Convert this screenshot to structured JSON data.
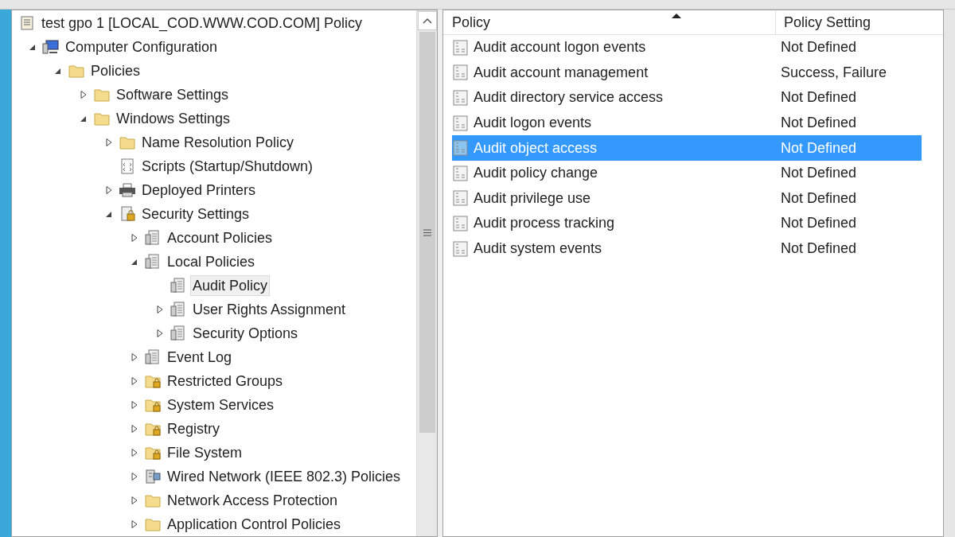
{
  "tree": {
    "label": "test gpo 1 [LOCAL_COD.WWW.COD.COM] Policy",
    "kind": "document",
    "selected": false,
    "children": [
      {
        "label": "Computer Configuration",
        "kind": "computer",
        "expanded": true,
        "selected": false,
        "children": [
          {
            "label": "Policies",
            "kind": "folder",
            "expanded": true,
            "selected": false,
            "children": [
              {
                "label": "Software Settings",
                "kind": "folder",
                "expanded": false,
                "selected": false
              },
              {
                "label": "Windows Settings",
                "kind": "folder",
                "expanded": true,
                "selected": false,
                "children": [
                  {
                    "label": "Name Resolution Policy",
                    "kind": "folder",
                    "expanded": false,
                    "selected": false
                  },
                  {
                    "label": "Scripts (Startup/Shutdown)",
                    "kind": "script",
                    "selected": false
                  },
                  {
                    "label": "Deployed Printers",
                    "kind": "printer",
                    "expanded": false,
                    "selected": false
                  },
                  {
                    "label": "Security Settings",
                    "kind": "security",
                    "expanded": true,
                    "selected": false,
                    "children": [
                      {
                        "label": "Account Policies",
                        "kind": "policy",
                        "expanded": false,
                        "selected": false
                      },
                      {
                        "label": "Local Policies",
                        "kind": "policy",
                        "expanded": true,
                        "selected": false,
                        "children": [
                          {
                            "label": "Audit Policy",
                            "kind": "policy",
                            "selected": true
                          },
                          {
                            "label": "User Rights Assignment",
                            "kind": "policy",
                            "expanded": false,
                            "selected": false
                          },
                          {
                            "label": "Security Options",
                            "kind": "policy",
                            "expanded": false,
                            "selected": false
                          }
                        ]
                      },
                      {
                        "label": "Event Log",
                        "kind": "policy",
                        "expanded": false,
                        "selected": false
                      },
                      {
                        "label": "Restricted Groups",
                        "kind": "locked-folder",
                        "expanded": false,
                        "selected": false
                      },
                      {
                        "label": "System Services",
                        "kind": "locked-folder",
                        "expanded": false,
                        "selected": false
                      },
                      {
                        "label": "Registry",
                        "kind": "locked-folder",
                        "expanded": false,
                        "selected": false
                      },
                      {
                        "label": "File System",
                        "kind": "locked-folder",
                        "expanded": false,
                        "selected": false
                      },
                      {
                        "label": "Wired Network (IEEE 802.3) Policies",
                        "kind": "network",
                        "expanded": false,
                        "selected": false
                      },
                      {
                        "label": "Network Access Protection",
                        "kind": "folder",
                        "expanded": false,
                        "selected": false
                      },
                      {
                        "label": "Application Control Policies",
                        "kind": "folder",
                        "expanded": false,
                        "selected": false
                      }
                    ]
                  }
                ]
              }
            ]
          }
        ]
      }
    ]
  },
  "table": {
    "columns": [
      "Policy",
      "Policy Setting"
    ],
    "rows": [
      {
        "policy": "Audit account logon events",
        "setting": "Not Defined",
        "selected": false
      },
      {
        "policy": "Audit account management",
        "setting": "Success, Failure",
        "selected": false
      },
      {
        "policy": "Audit directory service access",
        "setting": "Not Defined",
        "selected": false
      },
      {
        "policy": "Audit logon events",
        "setting": "Not Defined",
        "selected": false
      },
      {
        "policy": "Audit object access",
        "setting": "Not Defined",
        "selected": true
      },
      {
        "policy": "Audit policy change",
        "setting": "Not Defined",
        "selected": false
      },
      {
        "policy": "Audit privilege use",
        "setting": "Not Defined",
        "selected": false
      },
      {
        "policy": "Audit process tracking",
        "setting": "Not Defined",
        "selected": false
      },
      {
        "policy": "Audit system events",
        "setting": "Not Defined",
        "selected": false
      }
    ]
  }
}
